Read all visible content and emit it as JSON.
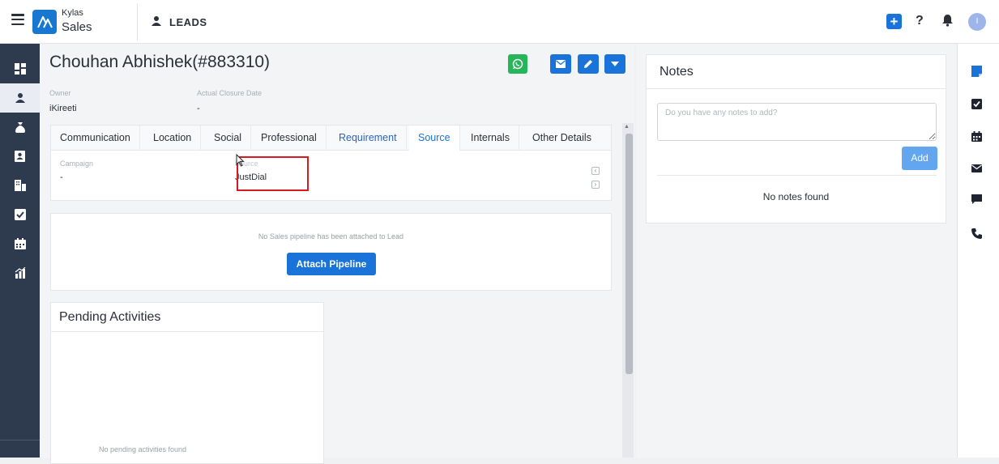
{
  "app": {
    "brand_top": "Kylas",
    "brand_main": "Sales",
    "module_title": "LEADS",
    "brand_color": "#1777d1",
    "accent_color": "#1a73d9",
    "avatar_initial": "I"
  },
  "topbar_icons": [
    "menu-icon",
    "plus-icon",
    "help-icon",
    "bell-icon",
    "avatar"
  ],
  "sidebar": {
    "items": [
      "dashboard-icon",
      "leads-icon",
      "deals-icon",
      "contacts-icon",
      "companies-icon",
      "tasks-icon",
      "calendar-icon",
      "reports-icon"
    ],
    "active": "leads-icon"
  },
  "lead": {
    "title": "Chouhan Abhishek(#883310)",
    "owner_label": "Owner",
    "owner_value": "iKireeti",
    "closure_label": "Actual Closure Date",
    "closure_value": "-"
  },
  "tabs": [
    {
      "label": "Communication"
    },
    {
      "label": "Location"
    },
    {
      "label": "Social"
    },
    {
      "label": "Professional"
    },
    {
      "label": "Requirement"
    },
    {
      "label": "Source"
    },
    {
      "label": "Internals"
    },
    {
      "label": "Other Details"
    }
  ],
  "selected_tab": "Source",
  "source_fields": {
    "campaign_label": "Campaign",
    "campaign_value": "-",
    "source_label": "Source",
    "source_value": "JustDial"
  },
  "pipeline": {
    "message": "No Sales pipeline has been attached to Lead",
    "button": "Attach Pipeline"
  },
  "pending": {
    "title": "Pending Activities",
    "empty": "No pending activities found"
  },
  "notes": {
    "title": "Notes",
    "placeholder": "Do you have any notes to add?",
    "add_button": "Add",
    "empty": "No notes found"
  },
  "right_rail": [
    "notes-icon",
    "tasks-icon",
    "calendar-icon",
    "email-icon",
    "chat-icon",
    "phone-icon"
  ]
}
